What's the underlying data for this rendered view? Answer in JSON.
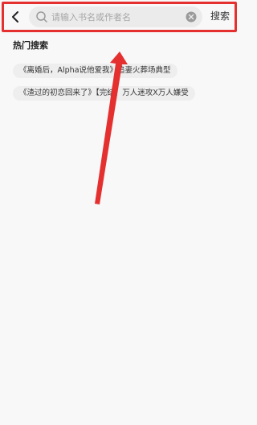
{
  "search": {
    "placeholder": "请输入书名或作者名",
    "value": "",
    "button_label": "搜索"
  },
  "hot_search": {
    "title": "热门搜索",
    "tags": [
      "《离婚后，Alpha说他爱我》追妻火葬场典型",
      "《渣过的初恋回来了》【完结】万人迷攻X万人嫌受"
    ]
  },
  "annotation": {
    "highlight_color": "#e53030"
  },
  "icons": {
    "back": "chevron-left-icon",
    "search": "search-icon",
    "clear": "clear-icon"
  }
}
